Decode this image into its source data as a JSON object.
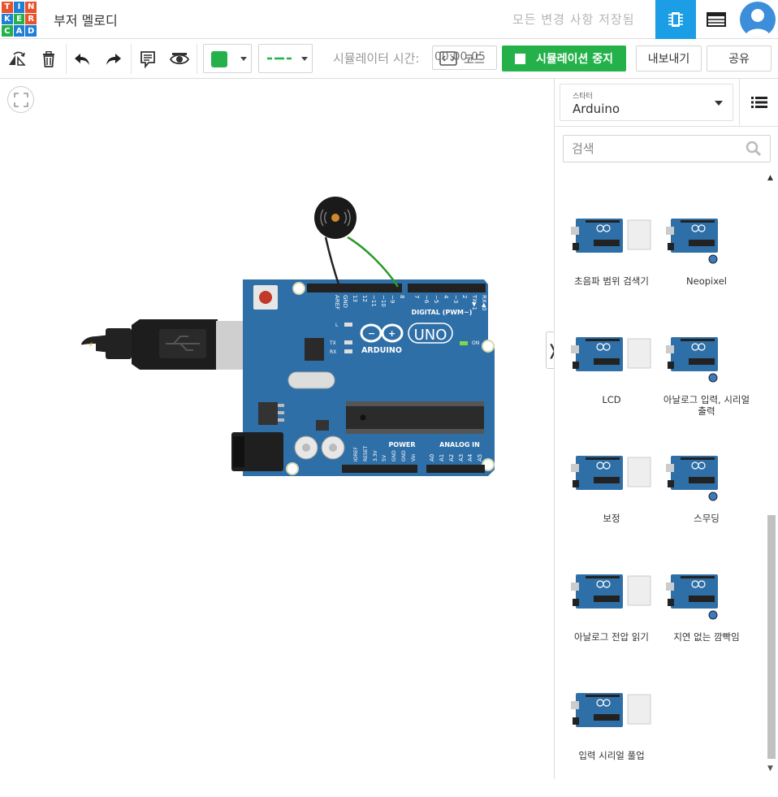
{
  "app": {
    "logo_letters": [
      "T",
      "I",
      "N",
      "K",
      "E",
      "R",
      "C",
      "A",
      "D"
    ],
    "logo_colors": [
      "#e8532c",
      "#1f7ed6",
      "#e8532c",
      "#1f7ed6",
      "#24b14a",
      "#e8532c",
      "#24b14a",
      "#1f7ed6",
      "#1f7ed6"
    ],
    "doc_title": "부저 멜로디",
    "save_status": "모든 변경 사항 저장됨"
  },
  "header_icons": {
    "circuit": "circuit-view-icon",
    "list": "component-list-icon",
    "avatar": "user-avatar-icon"
  },
  "toolbar": {
    "icons": [
      "rotate-icon",
      "delete-icon",
      "undo-icon",
      "redo-icon",
      "notes-icon",
      "visibility-icon"
    ],
    "wire_color": "#24b14a",
    "sim_time_label": "시뮬레이터 시간:",
    "sim_time_value": "00:00:05",
    "code_label": "코드",
    "stop_sim_label": "시뮬레이션 중지",
    "export_label": "내보내기",
    "share_label": "공유"
  },
  "sidepanel": {
    "select_label": "스타터",
    "select_value": "Arduino",
    "search_placeholder": "검색",
    "components": [
      {
        "name": "초음파 범위 검색기"
      },
      {
        "name": "Neopixel"
      },
      {
        "name": "LCD"
      },
      {
        "name": "아날로그 입력, 시리얼 출력"
      },
      {
        "name": "보정"
      },
      {
        "name": "스무딩"
      },
      {
        "name": "아날로그 전압 읽기"
      },
      {
        "name": "지연 없는 깜빡임"
      },
      {
        "name": "입력 시리얼 풀업"
      }
    ]
  },
  "board": {
    "brand": "ARDUINO",
    "model": "UNO",
    "digital_label": "DIGITAL (PWM~)",
    "power_label": "POWER",
    "analog_label": "ANALOG IN",
    "on_label": "ON",
    "pin_top": [
      "AREF",
      "GND",
      "13",
      "12",
      "~11",
      "~10",
      "~9",
      "8",
      "7",
      "~6",
      "~5",
      "4",
      "~3",
      "2",
      "TX▶1",
      "RX◀0"
    ],
    "pin_power": [
      "IOREF",
      "RESET",
      "3.3V",
      "5V",
      "GND",
      "GND",
      "Vin"
    ],
    "pin_analog": [
      "A0",
      "A1",
      "A2",
      "A3",
      "A4",
      "A5"
    ],
    "led_labels": [
      "L",
      "TX",
      "RX"
    ],
    "board_color": "#2f6fa7"
  }
}
